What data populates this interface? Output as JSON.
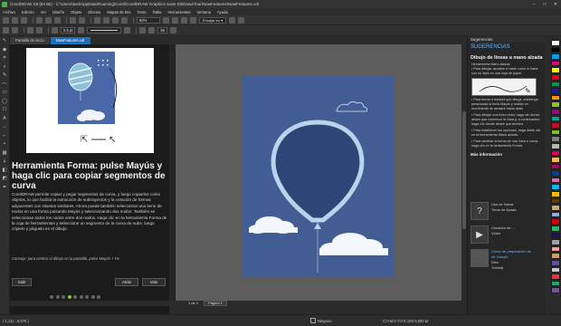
{
  "window": {
    "title": "CorelDRAW X8 (64 Bit) - C:\\Users\\test\\AppData\\Roaming\\Corel\\CorelDRAW Graphics Suite X8\\Draw\\Tour\\NewFeatures\\NewFeatures.cdr",
    "minimize": "–",
    "maximize": "□",
    "close": "✕"
  },
  "menu": [
    "Archivo",
    "Edición",
    "Ver",
    "Diseño",
    "Objeto",
    "Efectos",
    "Mapas de bits",
    "Texto",
    "Tabla",
    "Herramientas",
    "Ventana",
    "Ayuda"
  ],
  "toolbar": {
    "zoom": "60%",
    "snap": "Encajar en ▾",
    "zoom_level": "50"
  },
  "propbar": {
    "outline_width": "0,5 pt",
    "smoothing": "50"
  },
  "tabs": [
    {
      "label": "Pantalla de inicio",
      "active": false
    },
    {
      "label": "NewFeatures.cdr",
      "active": true
    }
  ],
  "welcome": {
    "heading": "Herramienta Forma: pulse Mayús y haga clic para copiar segmentos de curva",
    "description": "CorelDRAW permite copiar y pegar segmentos de curva, y luego copiarlos como objetos, lo que facilita la extracción de subtrayectos y la creación de formas adyacentes con siluetas similares. Ahora puede también seleccionar una serie de nodos en una forma pulsando Mayús y seleccionando dos nodos. También se seleccionan todos los nodos entre dos nodos. Haga clic en la herramienta Forma de la caja de herramientas y seleccione un segmento de la curva de nube, luego cópielo y péguelo en el dibujo.",
    "hint": "Consejo: para centrar el dibujo en la pantalla, pulse Mayús + F4.",
    "exit": "Salir",
    "prev": "Atrás",
    "next": "Vale"
  },
  "page_nav": {
    "counter": "1 de 1",
    "page_tab": "Página 1"
  },
  "docker": {
    "header": "Sugerencias",
    "title_bar": "SUGERENCIAS",
    "topic": "Dibujo de líneas a mano alzada",
    "tool": "Herramienta Mano alzada",
    "lines": [
      "• Para dibujar, arrastre el ratón como lo haría",
      "  con un lápiz en una hoja de papel.",
      "• Para borrar a medida que dibuja, mantenga",
      "  presionada la tecla Mayús y realice un",
      "  movimiento de arrastre hacia atrás.",
      "• Para dibujar una línea recta, haga clic donde",
      "  desee que comience la línea y, a continuación,",
      "  haga clic donde desee que termine.",
      "• Para establecer las opciones, haga doble clic",
      "  en la herramienta Mano alzada.",
      "• Para cambiar la forma de una línea o curva,",
      "  haga clic en la herramienta Forma."
    ],
    "more_info": "Más información",
    "items": [
      {
        "icon": "?",
        "line1": "Uso de líneas",
        "line2": "Tema de Ayuda"
      },
      {
        "icon": "▶",
        "line1": "Creación de ...",
        "line2": "Video"
      },
      {
        "icon": "",
        "line1": "Curso de preparación de ... de Joseph",
        "line2": "Diez",
        "line3": "Tutorial"
      }
    ]
  },
  "status": {
    "coords": "( 1,111 ; 8,670 )",
    "fill": "Ninguno",
    "outline": "C:0 M:0 Y:0 K:100  0,500 pt"
  },
  "palette": [
    "#ffffff",
    "#000000",
    "#00a0e9",
    "#e4007f",
    "#fff100",
    "#e60012",
    "#009944",
    "#1d2088",
    "#f39800",
    "#8fc31f",
    "#920783",
    "#00a29a",
    "#c30d23",
    "#7fbe25",
    "#7d7d7d",
    "#b5b5b5",
    "#e5004f",
    "#f8b551",
    "#a40b5d",
    "#004098",
    "#ea68a2",
    "#00b7ee",
    "#fabe00",
    "#6a3906",
    "#cfa972",
    "#88abda",
    "#d7000f",
    "#32b16c",
    "#1b1464",
    "#9e9e9f",
    "#f29c9f",
    "#c9a063",
    "#5f52a0",
    "#c8c9ca",
    "#e8383d",
    "#13ae67",
    "#745399"
  ],
  "colors": {
    "page_bg": "#425c94",
    "balloon": "#2c4677",
    "balloon_stroke": "#b9d4ea",
    "accent": "#1e6fb8"
  }
}
